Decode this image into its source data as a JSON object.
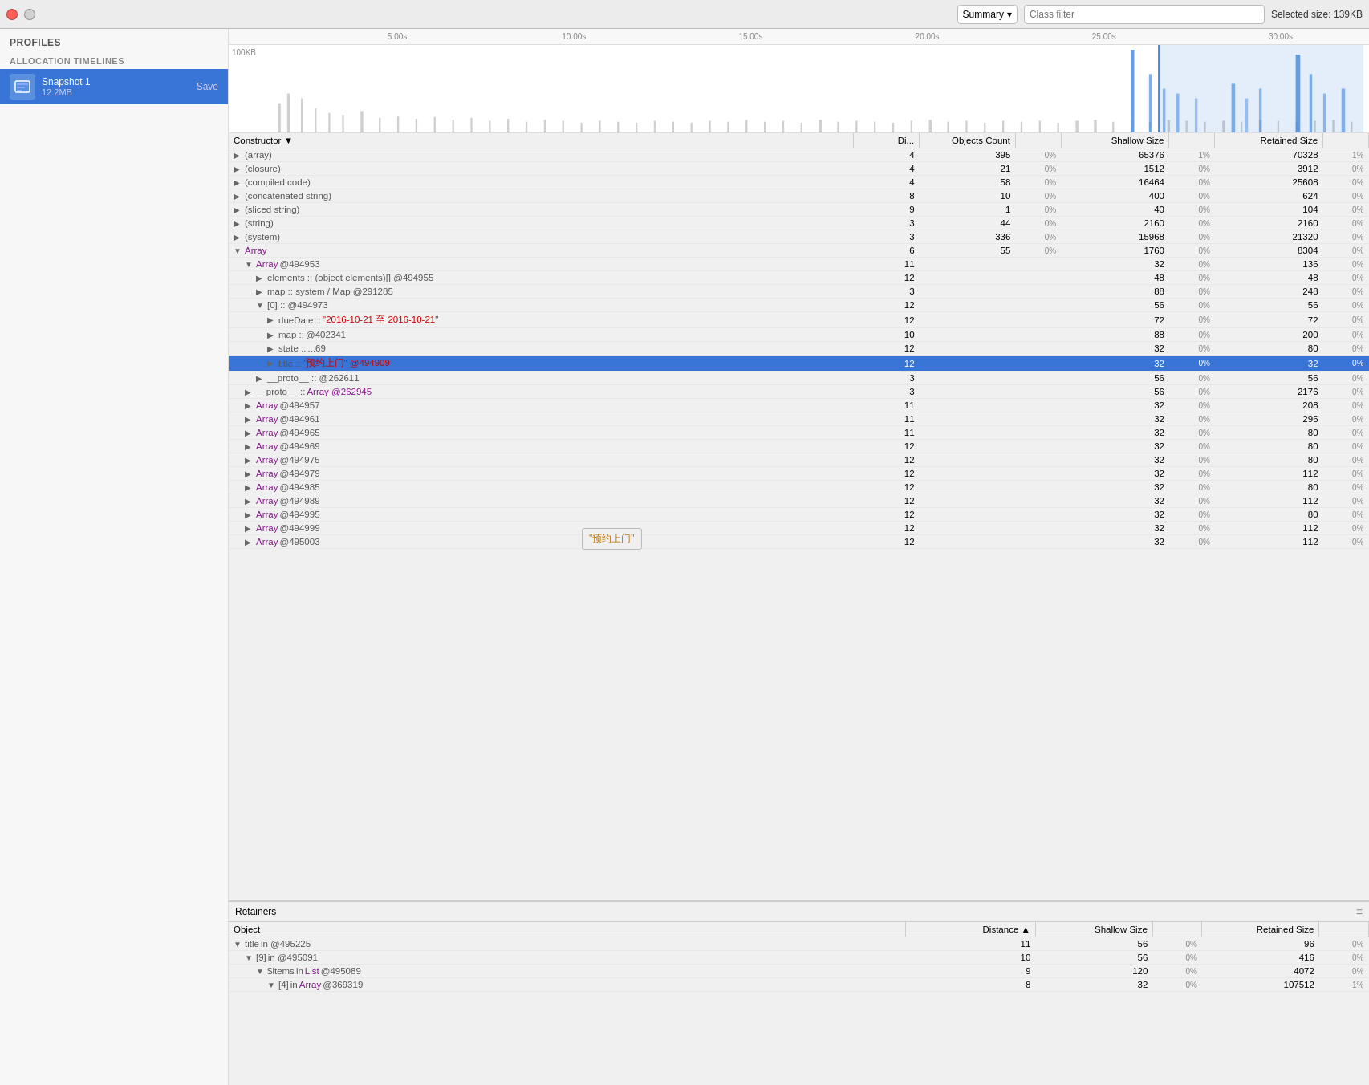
{
  "toolbar": {
    "close_btn": "close",
    "stop_btn": "stop",
    "summary_label": "Summary",
    "dropdown_icon": "▾",
    "class_filter_placeholder": "Class filter",
    "selected_size_label": "Selected size: 139KB"
  },
  "sidebar": {
    "profiles_label": "Profiles",
    "section_label": "ALLOCATION TIMELINES",
    "snapshot": {
      "name": "Snapshot 1",
      "size": "12.2MB",
      "save_label": "Save"
    }
  },
  "timeline": {
    "y_label": "100KB",
    "ticks": [
      "5.00s",
      "10.00s",
      "15.00s",
      "20.00s",
      "25.00s",
      "30.00s"
    ]
  },
  "main_table": {
    "columns": [
      {
        "key": "constructor",
        "label": "Constructor",
        "sort": "desc"
      },
      {
        "key": "distance",
        "label": "Di..."
      },
      {
        "key": "objects_count",
        "label": "Objects Count"
      },
      {
        "key": "shallow_size",
        "label": "Shallow Size"
      },
      {
        "key": "retained_size",
        "label": "Retained Size"
      }
    ],
    "rows": [
      {
        "indent": 0,
        "expand": "▶",
        "name": "(array)",
        "name_class": "cls-gray",
        "dist": "4",
        "obj_count": "395",
        "obj_pct": "0%",
        "shallow": "65376",
        "shallow_pct": "1%",
        "retained": "70328",
        "retained_pct": "1%",
        "selected": false
      },
      {
        "indent": 0,
        "expand": "▶",
        "name": "(closure)",
        "name_class": "cls-gray",
        "dist": "4",
        "obj_count": "21",
        "obj_pct": "0%",
        "shallow": "1512",
        "shallow_pct": "0%",
        "retained": "3912",
        "retained_pct": "0%",
        "selected": false
      },
      {
        "indent": 0,
        "expand": "▶",
        "name": "(compiled code)",
        "name_class": "cls-gray",
        "dist": "4",
        "obj_count": "58",
        "obj_pct": "0%",
        "shallow": "16464",
        "shallow_pct": "0%",
        "retained": "25608",
        "retained_pct": "0%",
        "selected": false
      },
      {
        "indent": 0,
        "expand": "▶",
        "name": "(concatenated string)",
        "name_class": "cls-gray",
        "dist": "8",
        "obj_count": "10",
        "obj_pct": "0%",
        "shallow": "400",
        "shallow_pct": "0%",
        "retained": "624",
        "retained_pct": "0%",
        "selected": false
      },
      {
        "indent": 0,
        "expand": "▶",
        "name": "(sliced string)",
        "name_class": "cls-gray",
        "dist": "9",
        "obj_count": "1",
        "obj_pct": "0%",
        "shallow": "40",
        "shallow_pct": "0%",
        "retained": "104",
        "retained_pct": "0%",
        "selected": false
      },
      {
        "indent": 0,
        "expand": "▶",
        "name": "(string)",
        "name_class": "cls-gray",
        "dist": "3",
        "obj_count": "44",
        "obj_pct": "0%",
        "shallow": "2160",
        "shallow_pct": "0%",
        "retained": "2160",
        "retained_pct": "0%",
        "selected": false
      },
      {
        "indent": 0,
        "expand": "▶",
        "name": "(system)",
        "name_class": "cls-gray",
        "dist": "3",
        "obj_count": "336",
        "obj_pct": "0%",
        "shallow": "15968",
        "shallow_pct": "0%",
        "retained": "21320",
        "retained_pct": "0%",
        "selected": false
      },
      {
        "indent": 0,
        "expand": "▼",
        "name": "Array",
        "name_class": "cls-array",
        "dist": "6",
        "obj_count": "55",
        "obj_pct": "0%",
        "shallow": "1760",
        "shallow_pct": "0%",
        "retained": "8304",
        "retained_pct": "0%",
        "selected": false
      },
      {
        "indent": 1,
        "expand": "▼",
        "name": "Array",
        "name_class": "cls-array",
        "name_suffix": " @494953",
        "suffix_class": "cls-gray",
        "dist": "11",
        "obj_count": "",
        "obj_pct": "",
        "shallow": "32",
        "shallow_pct": "0%",
        "retained": "136",
        "retained_pct": "0%",
        "selected": false
      },
      {
        "indent": 2,
        "expand": "▶",
        "name": "elements :: (object elements)[] @494955",
        "name_class": "cls-gray",
        "dist": "12",
        "obj_count": "",
        "obj_pct": "",
        "shallow": "48",
        "shallow_pct": "0%",
        "retained": "48",
        "retained_pct": "0%",
        "selected": false
      },
      {
        "indent": 2,
        "expand": "▶",
        "name": "map :: system / Map @291285",
        "name_class": "cls-gray",
        "dist": "3",
        "obj_count": "",
        "obj_pct": "",
        "shallow": "88",
        "shallow_pct": "0%",
        "retained": "248",
        "retained_pct": "0%",
        "selected": false
      },
      {
        "indent": 2,
        "expand": "▼",
        "name": "[0] :: @494973",
        "name_class": "cls-gray",
        "dist": "12",
        "obj_count": "",
        "obj_pct": "",
        "shallow": "56",
        "shallow_pct": "0%",
        "retained": "56",
        "retained_pct": "0%",
        "selected": false
      },
      {
        "indent": 3,
        "expand": "▶",
        "name": "dueDate :: ",
        "name_class": "cls-gray",
        "name_suffix": "\"2016-10-21 至 2016-10-21\"",
        "suffix_class": "cls-red",
        "dist": "12",
        "obj_count": "",
        "obj_pct": "",
        "shallow": "72",
        "shallow_pct": "0%",
        "retained": "72",
        "retained_pct": "0%",
        "selected": false
      },
      {
        "indent": 3,
        "expand": "▶",
        "name": "map :: ",
        "name_class": "cls-gray",
        "name_suffix": "@402341",
        "suffix_class": "cls-gray",
        "dist": "10",
        "obj_count": "",
        "obj_pct": "",
        "shallow": "88",
        "shallow_pct": "0%",
        "retained": "200",
        "retained_pct": "0%",
        "selected": false
      },
      {
        "indent": 3,
        "expand": "▶",
        "name": "state :: ",
        "name_class": "cls-gray",
        "name_suffix": "...69",
        "suffix_class": "cls-gray",
        "dist": "12",
        "obj_count": "",
        "obj_pct": "",
        "shallow": "32",
        "shallow_pct": "0%",
        "retained": "80",
        "retained_pct": "0%",
        "selected": false
      },
      {
        "indent": 3,
        "expand": "▶",
        "name": "title :: ",
        "name_class": "cls-gray",
        "name_suffix": "\"预约上门\" @494909",
        "suffix_class": "cls-red",
        "dist": "12",
        "obj_count": "",
        "obj_pct": "",
        "shallow": "32",
        "shallow_pct": "0%",
        "retained": "32",
        "retained_pct": "0%",
        "selected": true
      },
      {
        "indent": 2,
        "expand": "▶",
        "name": "__proto__ :: @262611",
        "name_class": "cls-gray",
        "dist": "3",
        "obj_count": "",
        "obj_pct": "",
        "shallow": "56",
        "shallow_pct": "0%",
        "retained": "56",
        "retained_pct": "0%",
        "selected": false
      },
      {
        "indent": 1,
        "expand": "▶",
        "name": "__proto__ :: ",
        "name_class": "cls-gray",
        "name_suffix": "Array @262945",
        "suffix_class": "cls-array",
        "dist": "3",
        "obj_count": "",
        "obj_pct": "",
        "shallow": "56",
        "shallow_pct": "0%",
        "retained": "2176",
        "retained_pct": "0%",
        "selected": false
      },
      {
        "indent": 1,
        "expand": "▶",
        "name": "Array",
        "name_class": "cls-array",
        "name_suffix": " @494957",
        "suffix_class": "cls-gray",
        "dist": "11",
        "obj_count": "",
        "obj_pct": "",
        "shallow": "32",
        "shallow_pct": "0%",
        "retained": "208",
        "retained_pct": "0%",
        "selected": false
      },
      {
        "indent": 1,
        "expand": "▶",
        "name": "Array",
        "name_class": "cls-array",
        "name_suffix": " @494961",
        "suffix_class": "cls-gray",
        "dist": "11",
        "obj_count": "",
        "obj_pct": "",
        "shallow": "32",
        "shallow_pct": "0%",
        "retained": "296",
        "retained_pct": "0%",
        "selected": false
      },
      {
        "indent": 1,
        "expand": "▶",
        "name": "Array",
        "name_class": "cls-array",
        "name_suffix": " @494965",
        "suffix_class": "cls-gray",
        "dist": "11",
        "obj_count": "",
        "obj_pct": "",
        "shallow": "32",
        "shallow_pct": "0%",
        "retained": "80",
        "retained_pct": "0%",
        "selected": false
      },
      {
        "indent": 1,
        "expand": "▶",
        "name": "Array",
        "name_class": "cls-array",
        "name_suffix": " @494969",
        "suffix_class": "cls-gray",
        "dist": "12",
        "obj_count": "",
        "obj_pct": "",
        "shallow": "32",
        "shallow_pct": "0%",
        "retained": "80",
        "retained_pct": "0%",
        "selected": false
      },
      {
        "indent": 1,
        "expand": "▶",
        "name": "Array",
        "name_class": "cls-array",
        "name_suffix": " @494975",
        "suffix_class": "cls-gray",
        "dist": "12",
        "obj_count": "",
        "obj_pct": "",
        "shallow": "32",
        "shallow_pct": "0%",
        "retained": "80",
        "retained_pct": "0%",
        "selected": false
      },
      {
        "indent": 1,
        "expand": "▶",
        "name": "Array",
        "name_class": "cls-array",
        "name_suffix": " @494979",
        "suffix_class": "cls-gray",
        "dist": "12",
        "obj_count": "",
        "obj_pct": "",
        "shallow": "32",
        "shallow_pct": "0%",
        "retained": "112",
        "retained_pct": "0%",
        "selected": false
      },
      {
        "indent": 1,
        "expand": "▶",
        "name": "Array",
        "name_class": "cls-array",
        "name_suffix": " @494985",
        "suffix_class": "cls-gray",
        "dist": "12",
        "obj_count": "",
        "obj_pct": "",
        "shallow": "32",
        "shallow_pct": "0%",
        "retained": "80",
        "retained_pct": "0%",
        "selected": false
      },
      {
        "indent": 1,
        "expand": "▶",
        "name": "Array",
        "name_class": "cls-array",
        "name_suffix": " @494989",
        "suffix_class": "cls-gray",
        "dist": "12",
        "obj_count": "",
        "obj_pct": "",
        "shallow": "32",
        "shallow_pct": "0%",
        "retained": "112",
        "retained_pct": "0%",
        "selected": false
      },
      {
        "indent": 1,
        "expand": "▶",
        "name": "Array",
        "name_class": "cls-array",
        "name_suffix": " @494995",
        "suffix_class": "cls-gray",
        "dist": "12",
        "obj_count": "",
        "obj_pct": "",
        "shallow": "32",
        "shallow_pct": "0%",
        "retained": "80",
        "retained_pct": "0%",
        "selected": false
      },
      {
        "indent": 1,
        "expand": "▶",
        "name": "Array",
        "name_class": "cls-array",
        "name_suffix": " @494999",
        "suffix_class": "cls-gray",
        "dist": "12",
        "obj_count": "",
        "obj_pct": "",
        "shallow": "32",
        "shallow_pct": "0%",
        "retained": "112",
        "retained_pct": "0%",
        "selected": false
      },
      {
        "indent": 1,
        "expand": "▶",
        "name": "Array",
        "name_class": "cls-array",
        "name_suffix": " @495003",
        "suffix_class": "cls-gray",
        "dist": "12",
        "obj_count": "",
        "obj_pct": "",
        "shallow": "32",
        "shallow_pct": "0%",
        "retained": "112",
        "retained_pct": "0%",
        "selected": false
      }
    ]
  },
  "tooltip": {
    "text": "\"预约上门\""
  },
  "retainers": {
    "header": "Retainers",
    "columns": [
      {
        "label": "Object"
      },
      {
        "label": "Distance ▲"
      },
      {
        "label": "Shallow Size"
      },
      {
        "label": "Retained Size"
      }
    ],
    "rows": [
      {
        "indent": 0,
        "expand": "▼",
        "name": "title",
        "name_class": "cls-gray",
        "name_suffix": " in @495225",
        "suffix_class": "cls-gray",
        "dist": "11",
        "shallow": "56",
        "shallow_pct": "0%",
        "retained": "96",
        "retained_pct": "0%"
      },
      {
        "indent": 1,
        "expand": "▼",
        "name": "[9]",
        "name_class": "cls-gray",
        "name_suffix": " in @495091",
        "suffix_class": "cls-gray",
        "dist": "10",
        "shallow": "56",
        "shallow_pct": "0%",
        "retained": "416",
        "retained_pct": "0%"
      },
      {
        "indent": 2,
        "expand": "▼",
        "name": "$items",
        "name_class": "cls-gray",
        "name_suffix": " in ",
        "name_suffix2": "List",
        "name_class2": "cls-array",
        "name_suffix3": " @495089",
        "suffix_class": "cls-gray",
        "dist": "9",
        "shallow": "120",
        "shallow_pct": "0%",
        "retained": "4072",
        "retained_pct": "0%"
      },
      {
        "indent": 3,
        "expand": "▼",
        "name": "[4]",
        "name_class": "cls-gray",
        "name_suffix": " in ",
        "name_suffix2": "Array",
        "name_class2": "cls-array",
        "name_suffix3": " @369319",
        "suffix_class": "cls-gray",
        "dist": "8",
        "shallow": "32",
        "shallow_pct": "0%",
        "retained": "107512",
        "retained_pct": "1%"
      }
    ]
  }
}
